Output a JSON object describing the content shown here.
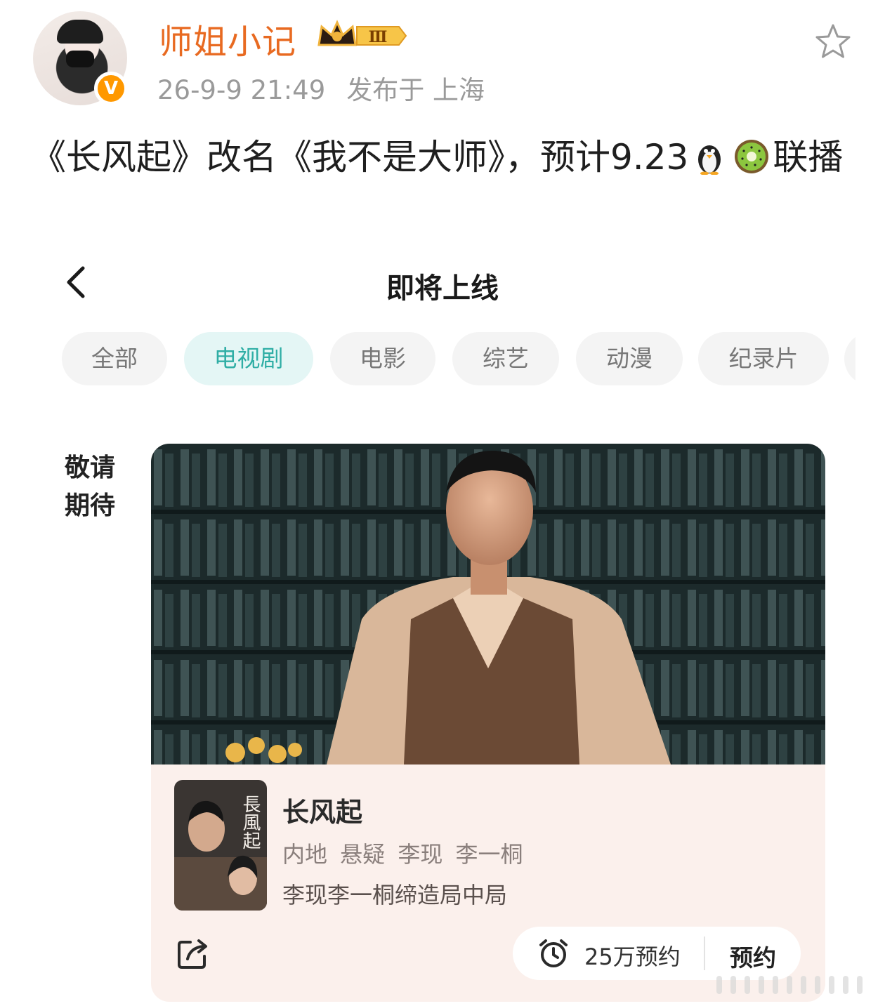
{
  "post": {
    "username": "师姐小记",
    "level_badge": "Ⅲ",
    "verified_badge": "V",
    "time": "26-9-9 21:49",
    "location": "发布于 上海",
    "text_part1": "《长风起》改名《我不是大师》，预计9.23",
    "text_part2": "联播",
    "emoji_1": "penguin-icon",
    "emoji_2": "kiwi-icon"
  },
  "embedded": {
    "page_title": "即将上线",
    "tabs": [
      {
        "label": "全部",
        "active": false
      },
      {
        "label": "电视剧",
        "active": true
      },
      {
        "label": "电影",
        "active": false
      },
      {
        "label": "综艺",
        "active": false
      },
      {
        "label": "动漫",
        "active": false
      },
      {
        "label": "纪录片",
        "active": false
      }
    ],
    "side_label": "敬请期待",
    "card": {
      "title": "长风起",
      "tags": "内地 悬疑 李现 李一桐",
      "description": "李现李一桐缔造局中局",
      "reserve_count": "25万预约",
      "reserve_button": "预约",
      "poster_text": "長風起"
    }
  },
  "colors": {
    "username": "#e86a21",
    "active_tab_text": "#2faea5",
    "active_tab_bg": "#e4f6f5",
    "card_bg": "#fbf0ec"
  }
}
